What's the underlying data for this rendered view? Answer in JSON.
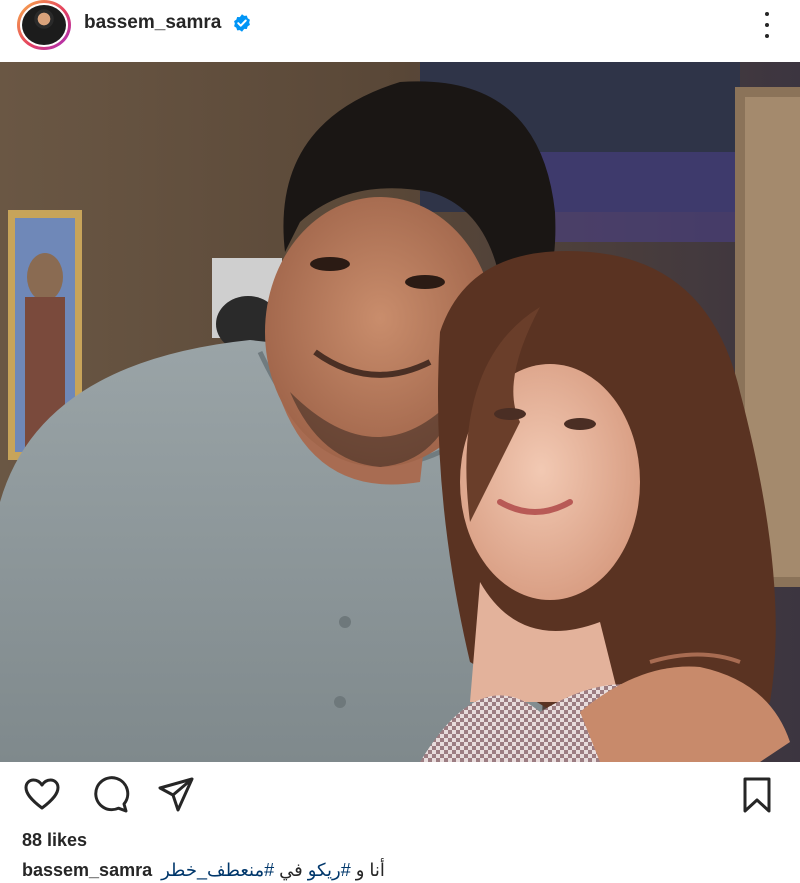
{
  "post": {
    "username": "bassem_samra",
    "verified": true,
    "likes": "88 likes",
    "caption_username": "bassem_samra",
    "caption": {
      "part1": "أنا و ",
      "tag1": "#ريكو",
      "part2": " في ",
      "tag2": "#منعطف_خطر"
    }
  },
  "icons": {
    "avatar": "profile-avatar",
    "verified": "verified-badge-icon",
    "more": "more-options-icon",
    "like": "heart-icon",
    "comment": "comment-icon",
    "share": "share-icon",
    "save": "bookmark-icon"
  },
  "colors": {
    "text": "#262626",
    "verified": "#0095f6",
    "hashtag": "#00376b"
  }
}
